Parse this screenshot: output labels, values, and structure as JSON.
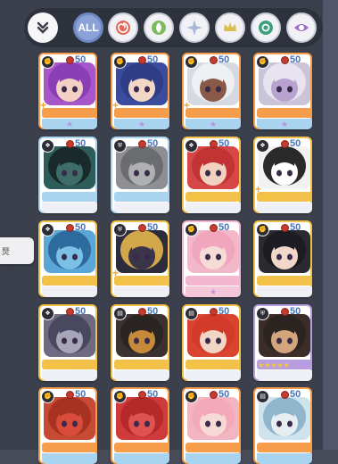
{
  "filter_bar": {
    "all_label": "ALL",
    "collapse_icon": "double-chevron-down-icon",
    "filters": [
      {
        "name": "all",
        "label": "ALL"
      },
      {
        "name": "fire",
        "icon": "spiral-icon",
        "color": "#e2685c"
      },
      {
        "name": "earth",
        "icon": "leaf-icon",
        "color": "#7cbb5b"
      },
      {
        "name": "wind",
        "icon": "star-burst-icon",
        "color": "#a6b8d6"
      },
      {
        "name": "light",
        "icon": "crown-icon",
        "color": "#d8c04f"
      },
      {
        "name": "water",
        "icon": "swirl-icon",
        "color": "#3d9f7c"
      },
      {
        "name": "dark",
        "icon": "eye-icon",
        "color": "#9b6fc8"
      }
    ]
  },
  "side_tab": {
    "label": "燹"
  },
  "cards": [
    {
      "cost": "50",
      "class": "fist",
      "plus": true,
      "stars": "",
      "rank": "★",
      "accent": "#f59d4b",
      "bg": "#a857c9",
      "skin": "#f3d0c4",
      "hair": "#8b3fb7"
    },
    {
      "cost": "50",
      "class": "fist",
      "plus": true,
      "stars": "",
      "rank": "★",
      "accent": "#f59d4b",
      "bg": "#3b4c9e",
      "skin": "#f2d7c9",
      "hair": "#2e3d86"
    },
    {
      "cost": "50",
      "class": "fist",
      "plus": true,
      "stars": "",
      "rank": "★",
      "accent": "#f59d4b",
      "bg": "#d5d9e2",
      "skin": "#8a5a48",
      "hair": "#eef0f4"
    },
    {
      "cost": "50",
      "class": "fist",
      "plus": false,
      "stars": "",
      "rank": "★",
      "accent": "#f59d4b",
      "bg": "#c9c4d8",
      "skin": "#b8a2d0",
      "hair": "#e7e3ef"
    },
    {
      "cost": "50",
      "class": "wind",
      "plus": false,
      "stars": "",
      "rank": "",
      "accent": "#a8d4ef",
      "bg": "#2d5d5a",
      "skin": "#3e6d68",
      "hair": "#1a2a2a"
    },
    {
      "cost": "50",
      "class": "shield",
      "plus": false,
      "stars": "",
      "rank": "",
      "accent": "#a8d4ef",
      "bg": "#8e8f92",
      "skin": "#aeb0b2",
      "hair": "#6b6c70"
    },
    {
      "cost": "50",
      "class": "wind",
      "plus": false,
      "stars": "★★★★★",
      "rank": "",
      "accent": "#f3c04a",
      "bg": "#d64747",
      "skin": "#f1d2c1",
      "hair": "#c23434"
    },
    {
      "cost": "50",
      "class": "wind",
      "plus": true,
      "stars": "★★★★",
      "rank": "",
      "accent": "#f3c04a",
      "bg": "#f2f2f2",
      "skin": "#ffffff",
      "hair": "#2a2a2a"
    },
    {
      "cost": "50",
      "class": "wind",
      "plus": false,
      "stars": "★★★★★",
      "rank": "",
      "accent": "#f3c04a",
      "bg": "#5aa6d6",
      "skin": "#7cc0e8",
      "hair": "#2d6b9e"
    },
    {
      "cost": "50",
      "class": "shield",
      "plus": true,
      "stars": "★★★★★",
      "rank": "",
      "accent": "#f3c04a",
      "bg": "#2c2c3c",
      "skin": "#3a3548",
      "hair": "#d2a84a"
    },
    {
      "cost": "50",
      "class": "fist",
      "plus": false,
      "stars": "",
      "rank": "★",
      "accent": "#f5b7d0",
      "bg": "#f0b8c8",
      "skin": "#f6dcd6",
      "hair": "#f2a6bd"
    },
    {
      "cost": "50",
      "class": "fist",
      "plus": false,
      "stars": "★★★★★",
      "rank": "",
      "accent": "#f3c04a",
      "bg": "#2a2a30",
      "skin": "#f1d7c9",
      "hair": "#1c1c22"
    },
    {
      "cost": "50",
      "class": "wind",
      "plus": false,
      "stars": "★★★★★",
      "rank": "",
      "accent": "#f3c04a",
      "bg": "#6e6a82",
      "skin": "#a7a6b8",
      "hair": "#4a4760"
    },
    {
      "cost": "50",
      "class": "book",
      "plus": false,
      "stars": "★★★★★",
      "rank": "",
      "accent": "#f3c04a",
      "bg": "#3a3230",
      "skin": "#c58b3a",
      "hair": "#2a2422"
    },
    {
      "cost": "50",
      "class": "book",
      "plus": false,
      "stars": "★★★★★",
      "rank": "",
      "accent": "#f3c04a",
      "bg": "#d8442f",
      "skin": "#f1d6c6",
      "hair": "#d23a2a"
    },
    {
      "cost": "50",
      "class": "shield",
      "plus": false,
      "stars": "★★★★★",
      "rank": "",
      "accent": "#b89de0",
      "bg": "#3b2e28",
      "skin": "#d3a57c",
      "hair": "#2b2420"
    },
    {
      "cost": "50",
      "class": "fist",
      "plus": false,
      "stars": "",
      "rank": "",
      "accent": "#f59d4b",
      "bg": "#c74a35",
      "skin": "#d94c3b",
      "hair": "#a73222"
    },
    {
      "cost": "50",
      "class": "fist",
      "plus": false,
      "stars": "",
      "rank": "",
      "accent": "#f59d4b",
      "bg": "#cf3b3b",
      "skin": "#e05252",
      "hair": "#b52929"
    },
    {
      "cost": "50",
      "class": "fist",
      "plus": false,
      "stars": "",
      "rank": "",
      "accent": "#f59d4b",
      "bg": "#f2b5c2",
      "skin": "#f6dad7",
      "hair": "#f3a9b9"
    },
    {
      "cost": "50",
      "class": "book",
      "plus": false,
      "stars": "",
      "rank": "",
      "accent": "#f59d4b",
      "bg": "#cfe3ec",
      "skin": "#e6eef2",
      "hair": "#8fb6cc"
    }
  ]
}
